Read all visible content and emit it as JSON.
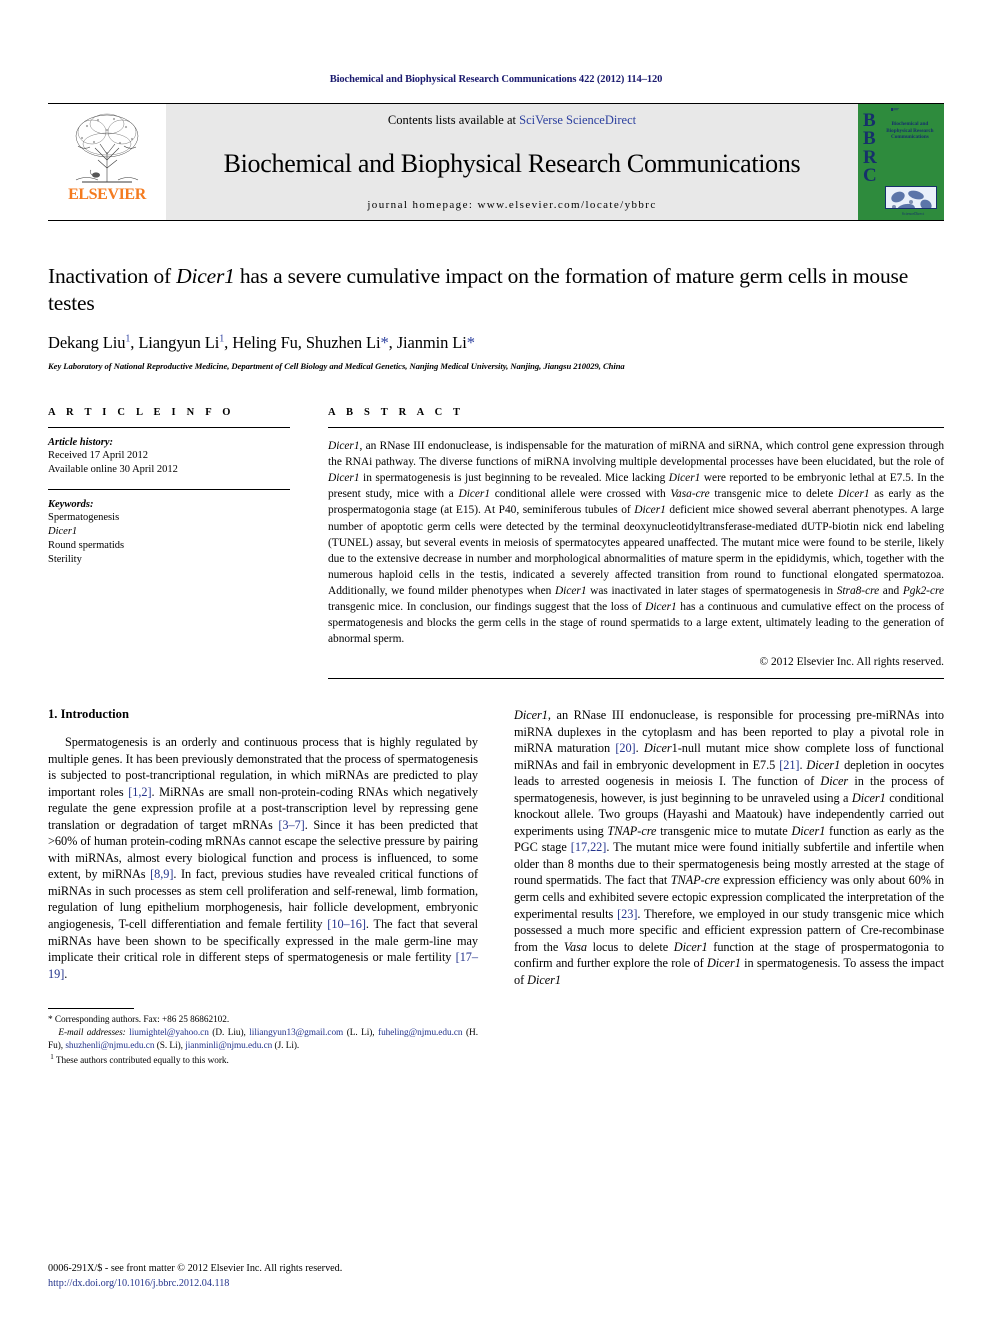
{
  "running_head": "Biochemical and Biophysical Research Communications 422 (2012) 114–120",
  "header": {
    "contents_prefix": "Contents lists available at ",
    "contents_link": "SciVerse ScienceDirect",
    "journal_title": "Biochemical and Biophysical Research Communications",
    "homepage_label": "journal homepage: www.elsevier.com/locate/ybbrc",
    "elsevier_wordmark": "ELSEVIER",
    "cover_letters": "BBRC",
    "cover_title": "Biochemical and Biophysical Research Communications"
  },
  "title": {
    "part1": "Inactivation of ",
    "italic1": "Dicer1",
    "part2": " has a severe cumulative impact on the formation of mature germ cells in mouse testes"
  },
  "authors_line": "Dekang Liu 1, Liangyun Li 1, Heling Fu, Shuzhen Li *, Jianmin Li *",
  "authors": [
    {
      "name": "Dekang Liu",
      "mark": "1"
    },
    {
      "name": "Liangyun Li",
      "mark": "1"
    },
    {
      "name": "Heling Fu",
      "mark": ""
    },
    {
      "name": "Shuzhen Li",
      "mark": "*"
    },
    {
      "name": "Jianmin Li",
      "mark": "*"
    }
  ],
  "affiliation": "Key Laboratory of National Reproductive Medicine, Department of Cell Biology and Medical Genetics, Nanjing Medical University, Nanjing, Jiangsu 210029, China",
  "article_info": {
    "label": "A R T I C L E    I N F O",
    "history_head": "Article history:",
    "history": [
      "Received 17 April 2012",
      "Available online 30 April 2012"
    ],
    "keywords_head": "Keywords:",
    "keywords": [
      "Spermatogenesis",
      "Dicer1",
      "Round spermatids",
      "Sterility"
    ]
  },
  "abstract": {
    "label": "A B S T R A C T",
    "text": "Dicer1, an RNase III endonuclease, is indispensable for the maturation of miRNA and siRNA, which control gene expression through the RNAi pathway. The diverse functions of miRNA involving multiple developmental processes have been elucidated, but the role of Dicer1 in spermatogenesis is just beginning to be revealed. Mice lacking Dicer1 were reported to be embryonic lethal at E7.5. In the present study, mice with a Dicer1 conditional allele were crossed with Vasa-cre transgenic mice to delete Dicer1 as early as the prospermatogonia stage (at E15). At P40, seminiferous tubules of Dicer1 deficient mice showed several aberrant phenotypes. A large number of apoptotic germ cells were detected by the terminal deoxynucleotidyltransferase-mediated dUTP-biotin nick end labeling (TUNEL) assay, but several events in meiosis of spermatocytes appeared unaffected. The mutant mice were found to be sterile, likely due to the extensive decrease in number and morphological abnormalities of mature sperm in the epididymis, which, together with the numerous haploid cells in the testis, indicated a severely affected transition from round to functional elongated spermatozoa. Additionally, we found milder phenotypes when Dicer1 was inactivated in later stages of spermatogenesis in Stra8-cre and Pgk2-cre transgenic mice. In conclusion, our findings suggest that the loss of Dicer1 has a continuous and cumulative effect on the process of spermatogenesis and blocks the germ cells in the stage of round spermatids to a large extent, ultimately leading to the generation of abnormal sperm.",
    "copyright": "© 2012 Elsevier Inc. All rights reserved."
  },
  "introduction": {
    "section_title": "1. Introduction",
    "para1": "Spermatogenesis is an orderly and continuous process that is highly regulated by multiple genes. It has been previously demonstrated that the process of spermatogenesis is subjected to post-trancriptional regulation, in which miRNAs are predicted to play important roles [1,2]. MiRNAs are small non-protein-coding RNAs which negatively regulate the gene expression profile at a post-transcription level by repressing gene translation or degradation of target mRNAs [3–7]. Since it has been predicted that >60% of human protein-coding mRNAs cannot escape the selective pressure by pairing with miRNAs, almost every biological function and process is influenced, to some extent, by miRNAs [8,9]. In fact, previous studies have revealed critical functions of miRNAs in such processes as stem cell proliferation and self-renewal, limb formation, regulation of lung epithelium morphogenesis, hair follicle development, embryonic angiogenesis, T-cell differentiation and female fertility [10–16]. The fact that several miRNAs have been shown to be specifically expressed in the male germ-line may implicate their critical role in different steps of spermatogenesis or male fertility [17–19].",
    "para2": "Dicer1, an RNase III endonuclease, is responsible for processing pre-miRNAs into miRNA duplexes in the cytoplasm and has been reported to play a pivotal role in miRNA maturation [20]. Dicer1-null mutant mice show complete loss of functional miRNAs and fail in embryonic development in E7.5 [21]. Dicer1 depletion in oocytes leads to arrested oogenesis in meiosis I. The function of Dicer in the process of spermatogenesis, however, is just beginning to be unraveled using a Dicer1 conditional knockout allele. Two groups (Hayashi and Maatouk) have independently carried out experiments using TNAP-cre transgenic mice to mutate Dicer1 function as early as the PGC stage [17,22]. The mutant mice were found initially subfertile and infertile when older than 8 months due to their spermatogenesis being mostly arrested at the stage of round spermatids. The fact that TNAP-cre expression efficiency was only about 60% in germ cells and exhibited severe ectopic expression complicated the interpretation of the experimental results [23]. Therefore, we employed in our study transgenic mice which possessed a much more specific and efficient expression pattern of Cre-recombinase from the Vasa locus to delete Dicer1 function at the stage of prospermatogonia to confirm and further explore the role of Dicer1 in spermatogenesis. To assess the impact of Dicer1"
  },
  "footnotes": {
    "corresponding": "Corresponding authors. Fax: +86 25 86862102.",
    "email_head": "E-mail addresses:",
    "emails": [
      {
        "addr": "liumightel@yahoo.cn",
        "who": "(D. Liu)"
      },
      {
        "addr": "liliangyun13@gmail.com",
        "who": "(L. Li)"
      },
      {
        "addr": "fuheling@njmu.edu.cn",
        "who": "(H. Fu)"
      },
      {
        "addr": "shuzhenli@njmu.edu.cn",
        "who": "(S. Li)"
      },
      {
        "addr": "jianminli@njmu.edu.cn",
        "who": "(J. Li)"
      }
    ],
    "equal_contribution": "These authors contributed equally to this work.",
    "equal_mark": "1"
  },
  "page_footer": {
    "front_matter": "0006-291X/$ - see front matter © 2012 Elsevier Inc. All rights reserved.",
    "doi": "http://dx.doi.org/10.1016/j.bbrc.2012.04.118"
  },
  "colors": {
    "link": "#24348c",
    "running_head": "#1a1a6e",
    "elsevier_orange": "#F47B20",
    "cover_green": "#2e8b3d",
    "band_gray": "#e8e8e8"
  }
}
